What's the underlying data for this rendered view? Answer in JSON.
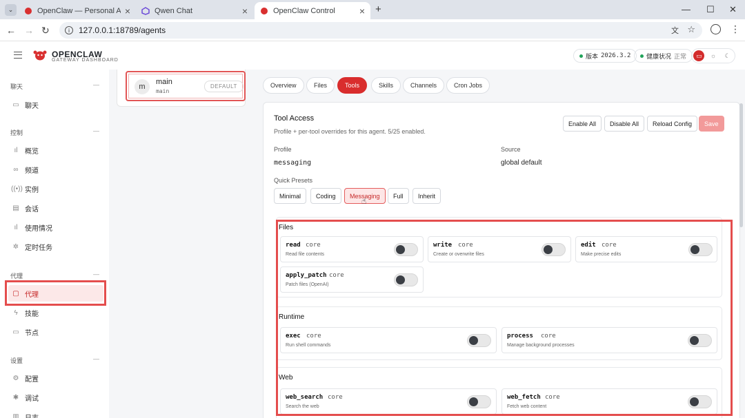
{
  "browser": {
    "tabs": [
      {
        "label": "OpenClaw — Personal AI Assistant",
        "active": false
      },
      {
        "label": "Qwen Chat",
        "active": false
      },
      {
        "label": "OpenClaw Control",
        "active": true
      }
    ],
    "url": "127.0.0.1:18789/agents"
  },
  "header": {
    "brand": "OPENCLAW",
    "subtitle": "GATEWAY DASHBOARD",
    "version_label": "版本",
    "version_value": "2026.3.2",
    "health_label": "健康状况",
    "health_value": "正常"
  },
  "sidebar": {
    "groups": [
      {
        "label": "聊天",
        "items": [
          {
            "label": "聊天",
            "icon": "chat-icon"
          }
        ]
      },
      {
        "label": "控制",
        "items": [
          {
            "label": "概览",
            "icon": "bar-chart-icon"
          },
          {
            "label": "频道",
            "icon": "link-icon"
          },
          {
            "label": "实例",
            "icon": "broadcast-icon"
          },
          {
            "label": "会话",
            "icon": "document-icon"
          },
          {
            "label": "使用情况",
            "icon": "bar-chart-icon"
          },
          {
            "label": "定时任务",
            "icon": "loader-icon"
          }
        ]
      },
      {
        "label": "代理",
        "items": [
          {
            "label": "代理",
            "icon": "folder-icon",
            "active": true
          },
          {
            "label": "技能",
            "icon": "bolt-icon"
          },
          {
            "label": "节点",
            "icon": "monitor-icon"
          }
        ]
      },
      {
        "label": "设置",
        "items": [
          {
            "label": "配置",
            "icon": "gear-icon"
          },
          {
            "label": "调试",
            "icon": "bug-icon"
          },
          {
            "label": "日志",
            "icon": "log-icon"
          }
        ]
      }
    ]
  },
  "agent": {
    "avatar": "m",
    "name": "main",
    "id": "main",
    "badge": "DEFAULT"
  },
  "tabs": [
    "Overview",
    "Files",
    "Tools",
    "Skills",
    "Channels",
    "Cron Jobs"
  ],
  "active_tab": "Tools",
  "panel": {
    "title": "Tool Access",
    "subtitle": "Profile + per-tool overrides for this agent. 5/25 enabled.",
    "buttons": {
      "enable_all": "Enable All",
      "disable_all": "Disable All",
      "reload": "Reload Config",
      "save": "Save"
    },
    "profile_label": "Profile",
    "profile_value": "messaging",
    "source_label": "Source",
    "source_value": "global default",
    "presets_label": "Quick Presets",
    "presets": [
      "Minimal",
      "Coding",
      "Messaging",
      "Full",
      "Inherit"
    ],
    "active_preset": "Messaging",
    "sections": [
      {
        "title": "Files",
        "tools": [
          {
            "name": "read",
            "tag": "core",
            "desc": "Read file contents",
            "enabled": false
          },
          {
            "name": "write",
            "tag": "core",
            "desc": "Create or overwrite files",
            "enabled": false
          },
          {
            "name": "edit",
            "tag": "core",
            "desc": "Make precise edits",
            "enabled": false
          },
          {
            "name": "apply_patch",
            "tag": "core",
            "desc": "Patch files (OpenAI)",
            "enabled": false
          }
        ]
      },
      {
        "title": "Runtime",
        "tools": [
          {
            "name": "exec",
            "tag": "core",
            "desc": "Run shell commands",
            "enabled": false
          },
          {
            "name": "process",
            "tag": "core",
            "desc": "Manage background processes",
            "enabled": false
          }
        ]
      },
      {
        "title": "Web",
        "tools": [
          {
            "name": "web_search",
            "tag": "core",
            "desc": "Search the web",
            "enabled": false
          },
          {
            "name": "web_fetch",
            "tag": "core",
            "desc": "Fetch web content",
            "enabled": false
          }
        ]
      }
    ]
  },
  "colors": {
    "accent": "#d92d2d",
    "highlight": "#e44d4d",
    "health": "#22a35a"
  }
}
